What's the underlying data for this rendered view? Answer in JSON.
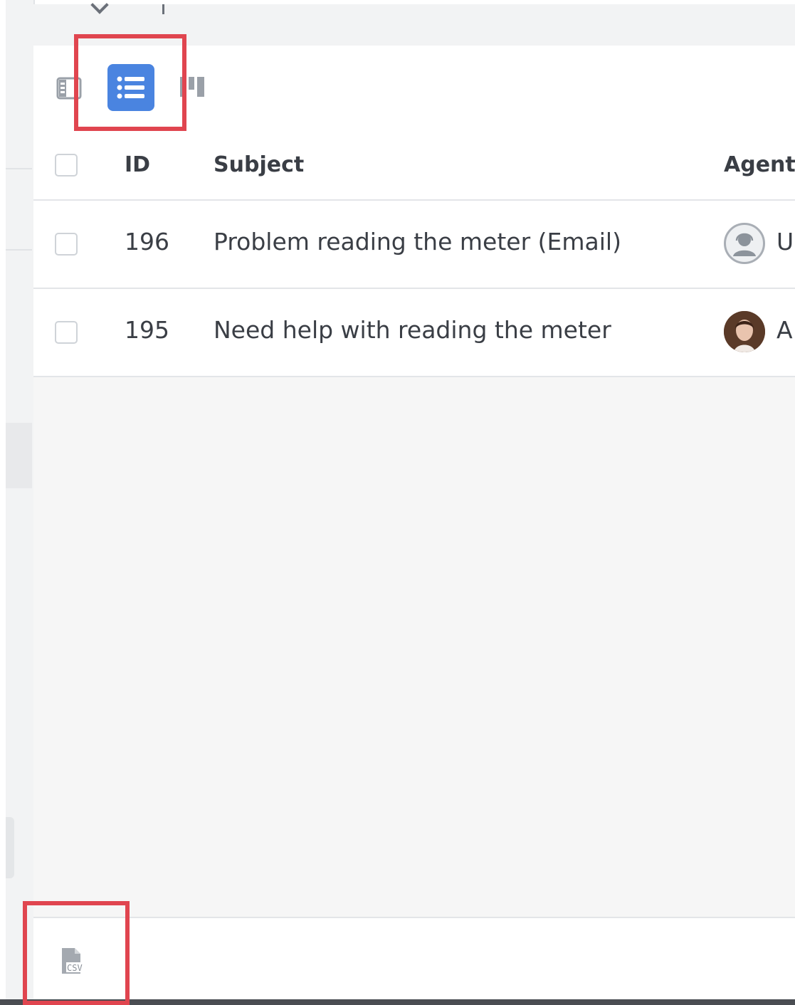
{
  "view_switcher": {
    "split_view_icon": "split-view-icon",
    "list_view_icon": "list-view-icon",
    "kanban_view_icon": "kanban-view-icon",
    "active_view": "list"
  },
  "table": {
    "columns": {
      "id": "ID",
      "subject": "Subject",
      "agent": "Agent"
    },
    "rows": [
      {
        "id": "196",
        "subject": "Problem reading the meter (Email)",
        "agent_initial": "U",
        "agent_avatar": "placeholder-avatar-icon"
      },
      {
        "id": "195",
        "subject": "Need help with reading the meter",
        "agent_initial": "A",
        "agent_avatar": "photo-avatar"
      }
    ]
  },
  "footer": {
    "csv_icon_label": "CSV"
  },
  "colors": {
    "accent": "#4a84e0",
    "highlight": "#e0454f",
    "border": "#e3e5e8"
  }
}
